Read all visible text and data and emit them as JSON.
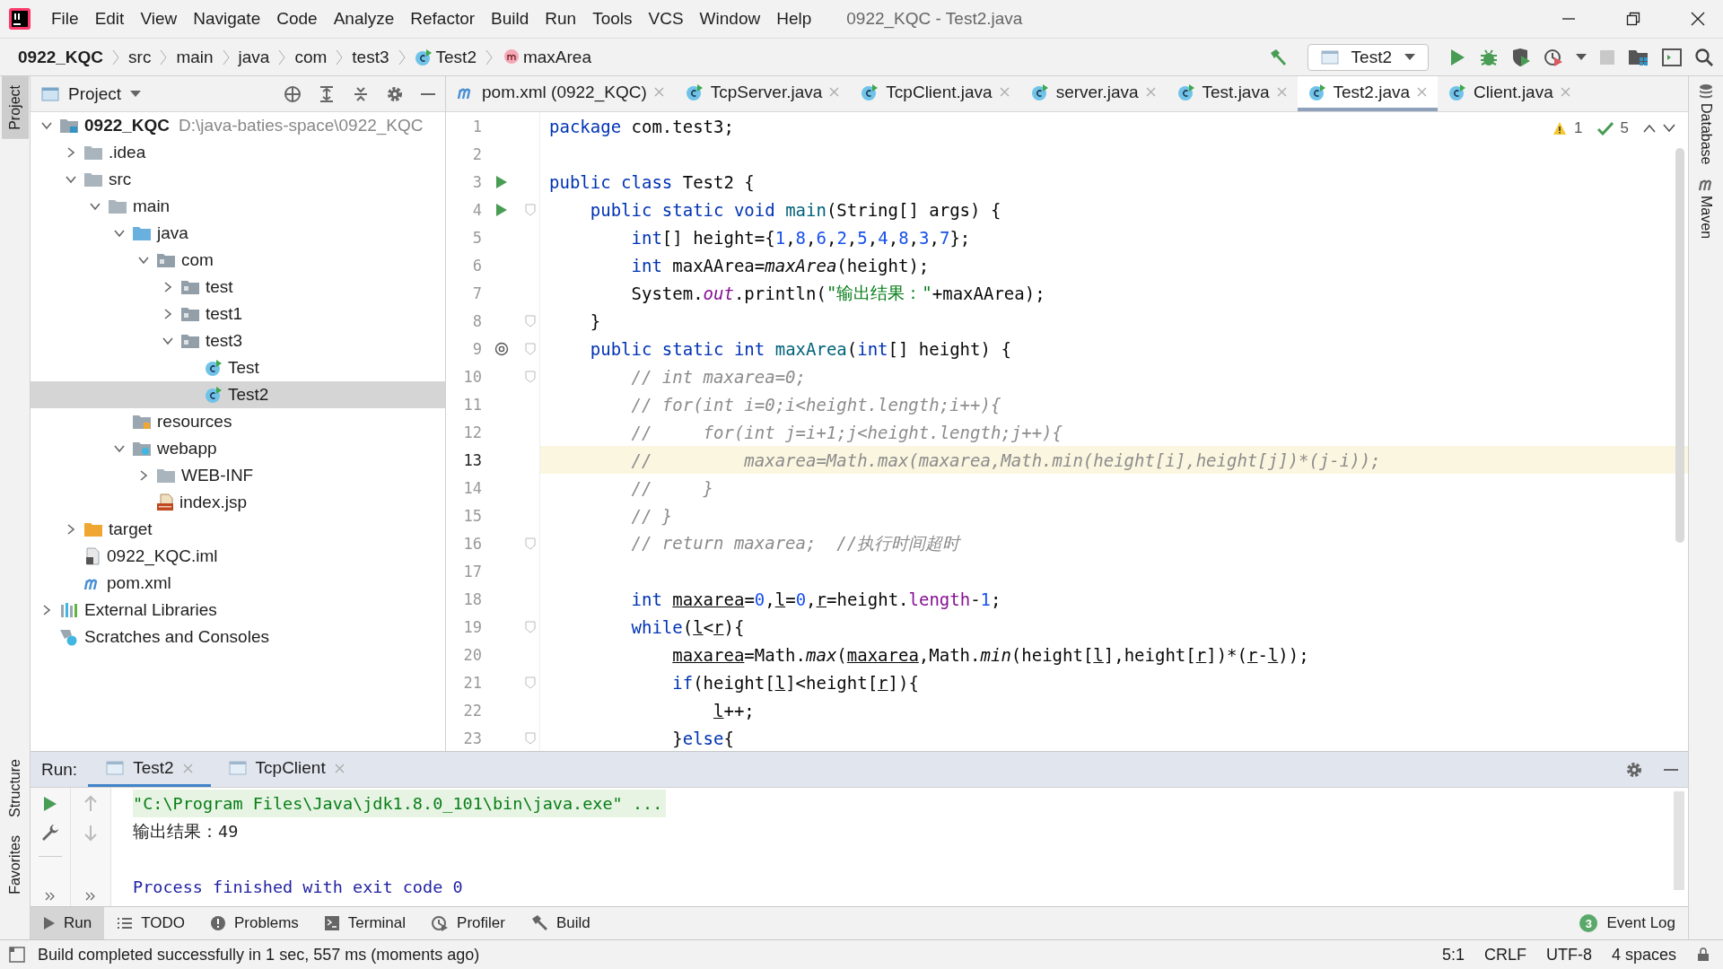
{
  "window": {
    "title": "0922_KQC - Test2.java"
  },
  "menu": [
    "File",
    "Edit",
    "View",
    "Navigate",
    "Code",
    "Analyze",
    "Refactor",
    "Build",
    "Run",
    "Tools",
    "VCS",
    "Window",
    "Help"
  ],
  "breadcrumbs": [
    {
      "label": "0922_KQC",
      "kind": "project"
    },
    {
      "label": "src",
      "kind": "dir"
    },
    {
      "label": "main",
      "kind": "dir"
    },
    {
      "label": "java",
      "kind": "dir"
    },
    {
      "label": "com",
      "kind": "dir"
    },
    {
      "label": "test3",
      "kind": "dir"
    },
    {
      "label": "Test2",
      "kind": "class"
    },
    {
      "label": "maxArea",
      "kind": "method"
    }
  ],
  "run_config": "Test2",
  "left_stripe": [
    {
      "label": "Project",
      "selected": true
    },
    {
      "label": "Structure",
      "selected": false
    },
    {
      "label": "Favorites",
      "selected": false
    }
  ],
  "right_stripe": [
    {
      "label": "Database",
      "kind": "database"
    },
    {
      "label": "Maven",
      "kind": "maven"
    }
  ],
  "project_panel": {
    "title": "Project",
    "tree": [
      {
        "name": "0922_KQC",
        "hint": "D:\\java-baties-space\\0922_KQC",
        "kind": "module",
        "expanded": true,
        "selected": false,
        "children": [
          {
            "name": ".idea",
            "kind": "folder",
            "expanded": false,
            "selected": false
          },
          {
            "name": "src",
            "kind": "folder",
            "expanded": true,
            "selected": false,
            "children": [
              {
                "name": "main",
                "kind": "folder",
                "expanded": true,
                "selected": false,
                "children": [
                  {
                    "name": "java",
                    "kind": "source",
                    "expanded": true,
                    "selected": false,
                    "children": [
                      {
                        "name": "com",
                        "kind": "package",
                        "expanded": true,
                        "selected": false,
                        "children": [
                          {
                            "name": "test",
                            "kind": "package",
                            "expanded": false,
                            "selected": false
                          },
                          {
                            "name": "test1",
                            "kind": "package",
                            "expanded": false,
                            "selected": false
                          },
                          {
                            "name": "test3",
                            "kind": "package",
                            "expanded": true,
                            "selected": false,
                            "children": [
                              {
                                "name": "Test",
                                "kind": "class",
                                "selected": false
                              },
                              {
                                "name": "Test2",
                                "kind": "class",
                                "selected": true
                              }
                            ]
                          }
                        ]
                      }
                    ]
                  },
                  {
                    "name": "resources",
                    "kind": "resources",
                    "selected": false
                  },
                  {
                    "name": "webapp",
                    "kind": "web",
                    "expanded": true,
                    "selected": false,
                    "children": [
                      {
                        "name": "WEB-INF",
                        "kind": "folder",
                        "expanded": false,
                        "selected": false
                      },
                      {
                        "name": "index.jsp",
                        "kind": "jsp",
                        "selected": false
                      }
                    ]
                  }
                ]
              }
            ]
          },
          {
            "name": "target",
            "kind": "excluded",
            "expanded": false,
            "selected": false
          },
          {
            "name": "0922_KQC.iml",
            "kind": "iml",
            "selected": false
          },
          {
            "name": "pom.xml",
            "kind": "maven",
            "selected": false
          }
        ]
      },
      {
        "name": "External Libraries",
        "kind": "libraries",
        "expanded": false,
        "selected": false
      },
      {
        "name": "Scratches and Consoles",
        "kind": "scratches",
        "selected": false
      }
    ]
  },
  "editor_tabs": [
    {
      "label": "pom.xml (0922_KQC)",
      "kind": "maven",
      "selected": false
    },
    {
      "label": "TcpServer.java",
      "kind": "class",
      "selected": false
    },
    {
      "label": "TcpClient.java",
      "kind": "class",
      "selected": false
    },
    {
      "label": "server.java",
      "kind": "class",
      "selected": false
    },
    {
      "label": "Test.java",
      "kind": "class",
      "selected": false
    },
    {
      "label": "Test2.java",
      "kind": "class",
      "selected": true
    },
    {
      "label": "Client.java",
      "kind": "class",
      "selected": false
    }
  ],
  "inspections": {
    "warnings": "1",
    "passed": "5"
  },
  "code": [
    {
      "number": "1",
      "kind": "plain",
      "current": false,
      "tokens": [
        {
          "kind": "keyword",
          "text": "package"
        },
        {
          "kind": "plain",
          "text": " com.test3;"
        }
      ]
    },
    {
      "number": "2",
      "kind": "plain",
      "current": false
    },
    {
      "number": "3",
      "kind": "run",
      "current": false,
      "tokens": [
        {
          "kind": "keyword",
          "text": "public class"
        },
        {
          "kind": "plain",
          "text": " Test2 {"
        }
      ]
    },
    {
      "number": "4",
      "kind": "run",
      "current": false,
      "fold": true,
      "tokens": [
        {
          "kind": "keyword",
          "text": "    public static void"
        },
        {
          "kind": "method",
          "text": " main"
        },
        {
          "kind": "plain",
          "text": "(String[] args) {"
        }
      ]
    },
    {
      "number": "5",
      "kind": "plain",
      "current": false,
      "tokens": [
        {
          "kind": "keyword",
          "text": "        int"
        },
        {
          "kind": "plain",
          "text": "[] height={"
        },
        {
          "kind": "number",
          "text": "1"
        },
        {
          "kind": "plain",
          "text": ","
        },
        {
          "kind": "number",
          "text": "8"
        },
        {
          "kind": "plain",
          "text": ","
        },
        {
          "kind": "number",
          "text": "6"
        },
        {
          "kind": "plain",
          "text": ","
        },
        {
          "kind": "number",
          "text": "2"
        },
        {
          "kind": "plain",
          "text": ","
        },
        {
          "kind": "number",
          "text": "5"
        },
        {
          "kind": "plain",
          "text": ","
        },
        {
          "kind": "number",
          "text": "4"
        },
        {
          "kind": "plain",
          "text": ","
        },
        {
          "kind": "number",
          "text": "8"
        },
        {
          "kind": "plain",
          "text": ","
        },
        {
          "kind": "number",
          "text": "3"
        },
        {
          "kind": "plain",
          "text": ","
        },
        {
          "kind": "number",
          "text": "7"
        },
        {
          "kind": "plain",
          "text": "};"
        }
      ]
    },
    {
      "number": "6",
      "kind": "plain",
      "current": false,
      "tokens": [
        {
          "kind": "keyword",
          "text": "        int"
        },
        {
          "kind": "plain",
          "text": " maxAArea="
        },
        {
          "kind": "call",
          "text": "maxArea"
        },
        {
          "kind": "plain",
          "text": "(height);"
        }
      ]
    },
    {
      "number": "7",
      "kind": "plain",
      "current": false,
      "tokens": [
        {
          "kind": "plain",
          "text": "        System."
        },
        {
          "kind": "field",
          "text": "out"
        },
        {
          "kind": "plain",
          "text": ".println("
        },
        {
          "kind": "string",
          "text": "\"输出结果：\""
        },
        {
          "kind": "plain",
          "text": "+maxAArea);"
        }
      ]
    },
    {
      "number": "8",
      "kind": "plain",
      "current": false,
      "fold": true,
      "tokens": [
        {
          "kind": "plain",
          "text": "    }"
        }
      ]
    },
    {
      "number": "9",
      "kind": "override",
      "current": false,
      "fold": true,
      "tokens": [
        {
          "kind": "keyword",
          "text": "    public static int"
        },
        {
          "kind": "method",
          "text": " maxArea"
        },
        {
          "kind": "plain",
          "text": "("
        },
        {
          "kind": "keyword",
          "text": "int"
        },
        {
          "kind": "plain",
          "text": "[] height) {"
        }
      ]
    },
    {
      "number": "10",
      "kind": "plain",
      "current": false,
      "fold": true,
      "tokens": [
        {
          "kind": "comment",
          "text": "        // int maxarea=0;"
        }
      ]
    },
    {
      "number": "11",
      "kind": "plain",
      "current": false,
      "tokens": [
        {
          "kind": "comment",
          "text": "        // for(int i=0;i<height.length;i++){"
        }
      ]
    },
    {
      "number": "12",
      "kind": "plain",
      "current": false,
      "tokens": [
        {
          "kind": "comment",
          "text": "        //     for(int j=i+1;j<height.length;j++){"
        }
      ]
    },
    {
      "number": "13",
      "kind": "plain",
      "current": true,
      "tokens": [
        {
          "kind": "comment",
          "text": "        //         maxarea=Math.max(maxarea,Math.min(height[i],height[j])*(j-i));"
        }
      ]
    },
    {
      "number": "14",
      "kind": "plain",
      "current": false,
      "tokens": [
        {
          "kind": "comment",
          "text": "        //     }"
        }
      ]
    },
    {
      "number": "15",
      "kind": "plain",
      "current": false,
      "tokens": [
        {
          "kind": "comment",
          "text": "        // }"
        }
      ]
    },
    {
      "number": "16",
      "kind": "plain",
      "current": false,
      "fold": true,
      "tokens": [
        {
          "kind": "comment",
          "text": "        // return maxarea;  //执行时间超时"
        }
      ]
    },
    {
      "number": "17",
      "kind": "plain",
      "current": false
    },
    {
      "number": "18",
      "kind": "plain",
      "current": false,
      "tokens": [
        {
          "kind": "keyword",
          "text": "        int"
        },
        {
          "kind": "var",
          "text": " maxarea"
        },
        {
          "kind": "plain",
          "text": "="
        },
        {
          "kind": "number",
          "text": "0"
        },
        {
          "kind": "plain",
          "text": ","
        },
        {
          "kind": "var",
          "text": "l"
        },
        {
          "kind": "plain",
          "text": "="
        },
        {
          "kind": "number",
          "text": "0"
        },
        {
          "kind": "plain",
          "text": ","
        },
        {
          "kind": "var",
          "text": "r"
        },
        {
          "kind": "plain",
          "text": "=height."
        },
        {
          "kind": "member",
          "text": "length"
        },
        {
          "kind": "plain",
          "text": "-"
        },
        {
          "kind": "number",
          "text": "1"
        },
        {
          "kind": "plain",
          "text": ";"
        }
      ]
    },
    {
      "number": "19",
      "kind": "plain",
      "current": false,
      "fold": true,
      "tokens": [
        {
          "kind": "keyword",
          "text": "        while"
        },
        {
          "kind": "plain",
          "text": "("
        },
        {
          "kind": "var",
          "text": "l"
        },
        {
          "kind": "plain",
          "text": "<"
        },
        {
          "kind": "var",
          "text": "r"
        },
        {
          "kind": "plain",
          "text": "){"
        }
      ]
    },
    {
      "number": "20",
      "kind": "plain",
      "current": false,
      "tokens": [
        {
          "kind": "var",
          "text": "            maxarea"
        },
        {
          "kind": "plain",
          "text": "=Math."
        },
        {
          "kind": "call",
          "text": "max"
        },
        {
          "kind": "plain",
          "text": "("
        },
        {
          "kind": "var",
          "text": "maxarea"
        },
        {
          "kind": "plain",
          "text": ",Math."
        },
        {
          "kind": "call",
          "text": "min"
        },
        {
          "kind": "plain",
          "text": "(height["
        },
        {
          "kind": "var",
          "text": "l"
        },
        {
          "kind": "plain",
          "text": "],height["
        },
        {
          "kind": "var",
          "text": "r"
        },
        {
          "kind": "plain",
          "text": "])*("
        },
        {
          "kind": "var",
          "text": "r"
        },
        {
          "kind": "plain",
          "text": "-"
        },
        {
          "kind": "var",
          "text": "l"
        },
        {
          "kind": "plain",
          "text": "));"
        }
      ]
    },
    {
      "number": "21",
      "kind": "plain",
      "current": false,
      "fold": true,
      "tokens": [
        {
          "kind": "keyword",
          "text": "            if"
        },
        {
          "kind": "plain",
          "text": "(height["
        },
        {
          "kind": "var",
          "text": "l"
        },
        {
          "kind": "plain",
          "text": "]<height["
        },
        {
          "kind": "var",
          "text": "r"
        },
        {
          "kind": "plain",
          "text": "]){"
        }
      ]
    },
    {
      "number": "22",
      "kind": "plain",
      "current": false,
      "tokens": [
        {
          "kind": "var",
          "text": "                l"
        },
        {
          "kind": "plain",
          "text": "++;"
        }
      ]
    },
    {
      "number": "23",
      "kind": "plain",
      "current": false,
      "fold": true,
      "tokens": [
        {
          "kind": "plain",
          "text": "            }"
        },
        {
          "kind": "keyword",
          "text": "else"
        },
        {
          "kind": "plain",
          "text": "{"
        }
      ]
    }
  ],
  "run_panel": {
    "title": "Run:",
    "tabs": [
      {
        "label": "Test2",
        "selected": true
      },
      {
        "label": "TcpClient",
        "selected": false
      }
    ],
    "console": [
      {
        "kind": "command",
        "text": "\"C:\\Program Files\\Java\\jdk1.8.0_101\\bin\\java.exe\" ..."
      },
      {
        "kind": "output",
        "text": "输出结果：49"
      },
      {
        "kind": "exit",
        "text": "Process finished with exit code 0"
      }
    ]
  },
  "tool_windows": [
    {
      "label": "Run",
      "kind": "run",
      "selected": true
    },
    {
      "label": "TODO",
      "kind": "list",
      "selected": false
    },
    {
      "label": "Problems",
      "kind": "problems",
      "selected": false
    },
    {
      "label": "Terminal",
      "kind": "terminal",
      "selected": false
    },
    {
      "label": "Profiler",
      "kind": "profiler",
      "selected": false
    },
    {
      "label": "Build",
      "kind": "build",
      "selected": false
    }
  ],
  "event_log": {
    "label": "Event Log",
    "count": "3"
  },
  "status_bar": {
    "message": "Build completed successfully in 1 sec, 557 ms (moments ago)",
    "items": [
      "5:1",
      "CRLF",
      "UTF-8",
      "4 spaces"
    ]
  }
}
